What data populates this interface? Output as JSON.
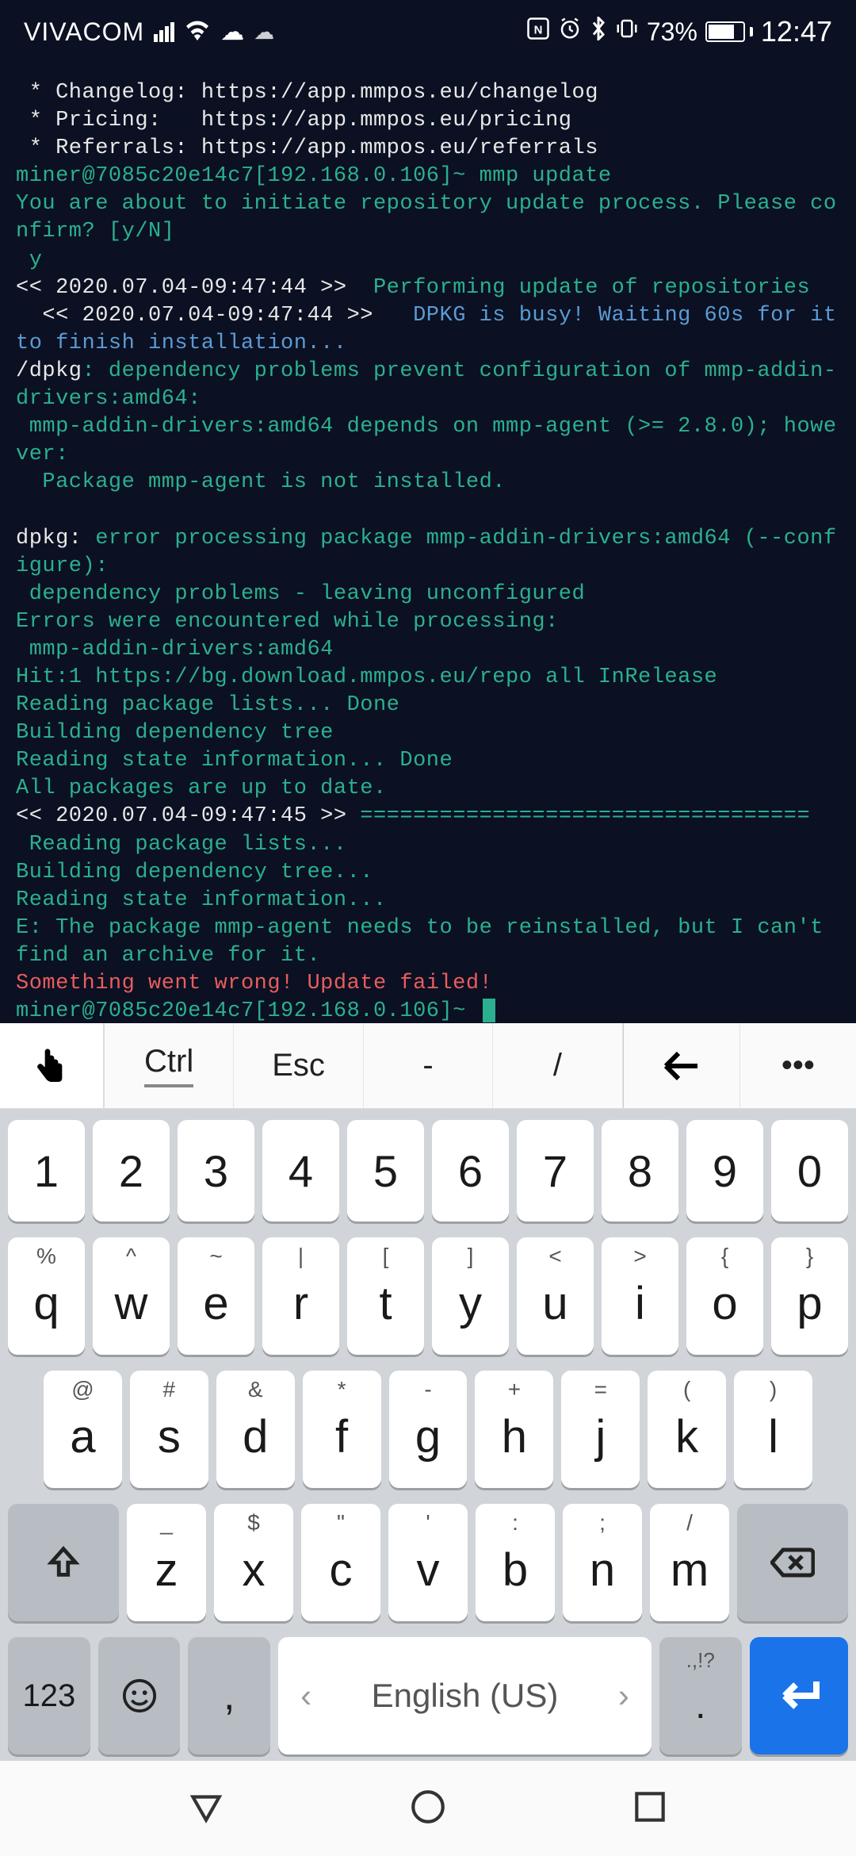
{
  "status": {
    "carrier": "VIVACOM",
    "battery_pct": "73%",
    "time": "12:47"
  },
  "terminal": {
    "l1": " * Changelog: https://app.mmpos.eu/changelog",
    "l2": " * Pricing:   https://app.mmpos.eu/pricing",
    "l3": " * Referrals: https://app.mmpos.eu/referrals",
    "l4": "",
    "l5": "miner@7085c20e14c7[192.168.0.106]~ mmp update",
    "l6": "You are about to initiate repository update process. Please confirm? [y/N]",
    "l7": " y",
    "l8a": "<< 2020.07.04-09:47:44 >> ",
    "l8b": " Performing update of repositories",
    "l9a": "  << 2020.07.04-09:47:44 >> ",
    "l9b": "  DPKG is busy! Waiting 60s for it to finish installation...",
    "l10a": "/dpkg",
    "l10b": ": dependency problems prevent configuration of mmp-addin-drivers:amd64:",
    "l11": " mmp-addin-drivers:amd64 depends on mmp-agent (>= 2.8.0); however:",
    "l12": "  Package mmp-agent is not installed.",
    "l13": "",
    "l14a": "dpkg:",
    "l14b": " error processing package mmp-addin-drivers:amd64 (--configure):",
    "l15": " dependency problems - leaving unconfigured",
    "l16": "Errors were encountered while processing:",
    "l17": " mmp-addin-drivers:amd64",
    "l18": "Hit:1 https://bg.download.mmpos.eu/repo all InRelease",
    "l19": "Reading package lists... Done",
    "l20": "Building dependency tree",
    "l21": "Reading state information... Done",
    "l22": "All packages are up to date.",
    "l23a": "<< 2020.07.04-09:47:45 >> ",
    "l23b": "==================================",
    "l24": " Reading package lists...",
    "l25": "Building dependency tree...",
    "l26": "Reading state information...",
    "l27": "E: The package mmp-agent needs to be reinstalled, but I can't find an archive for it.",
    "l28": "Something went wrong! Update failed!",
    "l29": "miner@7085c20e14c7[192.168.0.106]~ "
  },
  "toolbar": {
    "ctrl": "Ctrl",
    "esc": "Esc",
    "dash": "-",
    "slash": "/",
    "more": "•••"
  },
  "keyboard": {
    "row_num": [
      "1",
      "2",
      "3",
      "4",
      "5",
      "6",
      "7",
      "8",
      "9",
      "0"
    ],
    "row_q_alt": [
      "%",
      "^",
      "~",
      "|",
      "[",
      "]",
      "<",
      ">",
      "{",
      "}"
    ],
    "row_q": [
      "q",
      "w",
      "e",
      "r",
      "t",
      "y",
      "u",
      "i",
      "o",
      "p"
    ],
    "row_a_alt": [
      "@",
      "#",
      "&",
      "*",
      "-",
      "+",
      "=",
      "(",
      ")"
    ],
    "row_a": [
      "a",
      "s",
      "d",
      "f",
      "g",
      "h",
      "j",
      "k",
      "l"
    ],
    "row_z_alt": [
      "_",
      "$",
      "\"",
      "'",
      ":",
      ";",
      "/"
    ],
    "row_z": [
      "z",
      "x",
      "c",
      "v",
      "b",
      "n",
      "m"
    ],
    "mode": "123",
    "comma": ",",
    "space_left": "‹",
    "space_lang": "English (US)",
    "space_right": "›",
    "period_alt": ".,!?",
    "period": "."
  }
}
